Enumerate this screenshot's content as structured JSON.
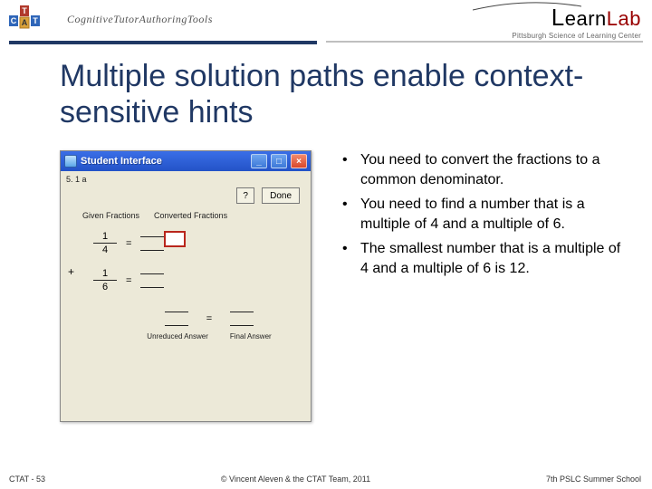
{
  "header": {
    "logo_text": "CTAT",
    "logo_subtitle": "CognitiveTutorAuthoringTools",
    "learnlab_lead": "L",
    "learnlab_mid": "earn",
    "learnlab_accent": "Lab",
    "learnlab_tag": "Pittsburgh Science of Learning Center"
  },
  "title": "Multiple solution paths enable context-sensitive hints",
  "window": {
    "title": "Student Interface",
    "address": "5. 1 a",
    "hint_btn": "?",
    "done_btn": "Done",
    "col1": "Given Fractions",
    "col2": "Converted Fractions",
    "f1_num": "1",
    "f1_den": "4",
    "f2_num": "1",
    "f2_den": "6",
    "plus": "+",
    "eq": "=",
    "lbl_unreduced": "Unreduced Answer",
    "lbl_final": "Final Answer"
  },
  "bullets": [
    "You need to convert the fractions to a common denominator.",
    "You need to find a number that is a multiple of 4 and a multiple of 6.",
    "The smallest number that is a multiple of 4 and a multiple of 6 is 12."
  ],
  "footer": {
    "left": "CTAT - 53",
    "center": "© Vincent Aleven & the CTAT Team, 2011",
    "right": "7th PSLC Summer School"
  }
}
